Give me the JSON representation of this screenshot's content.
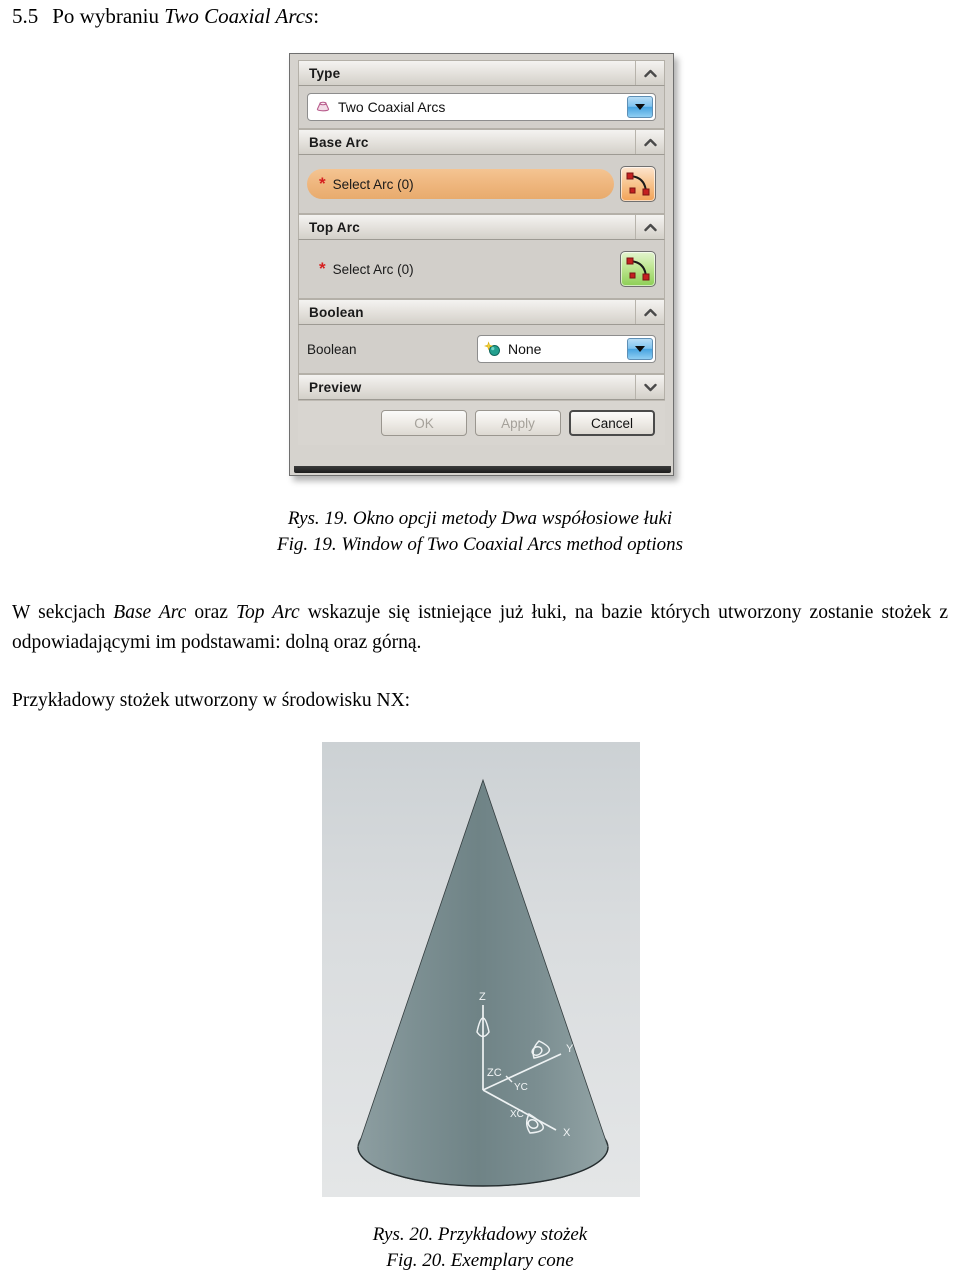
{
  "document": {
    "heading": {
      "number": "5.5",
      "text_before": "Po wybraniu ",
      "italic_term": "Two Coaxial Arcs",
      "text_after": ":"
    },
    "paragraph_1": {
      "seg_1": "W sekcjach ",
      "italic_1": "Base Arc",
      "seg_2": " oraz ",
      "italic_2": "Top Arc",
      "seg_3": " wskazuje się istniejące już łuki, na bazie których utworzony zostanie stożek z odpowiadającymi im podstawami: dolną oraz górną."
    },
    "paragraph_2": "Przykładowy stożek utworzony w środowisku NX:",
    "caption_19": {
      "line_pl": "Rys. 19. Okno opcji metody Dwa współosiowe łuki",
      "line_en": "Fig. 19. Window of Two Coaxial Arcs method options"
    },
    "caption_20": {
      "line_pl": "Rys. 20. Przykładowy stożek",
      "line_en": "Fig. 20. Exemplary cone"
    }
  },
  "dialog": {
    "groups": {
      "type": {
        "header": "Type",
        "chevron": "collapse-up",
        "combo": {
          "value": "Two Coaxial Arcs",
          "icon": "cone-shape-icon",
          "icon_color": "#c2739a"
        }
      },
      "base_arc": {
        "header": "Base Arc",
        "chevron": "collapse-up",
        "required_marker": "*",
        "select_label": "Select Arc (0)",
        "highlighted": true,
        "button_icon": "arc-curve-icon",
        "button_color": "#f2a257"
      },
      "top_arc": {
        "header": "Top Arc",
        "chevron": "collapse-up",
        "required_marker": "*",
        "select_label": "Select Arc (0)",
        "highlighted": false,
        "button_icon": "arc-curve-icon",
        "button_color": "#8dcf55"
      },
      "boolean": {
        "header": "Boolean",
        "chevron": "collapse-up",
        "field_label": "Boolean",
        "combo": {
          "value": "None",
          "icon": "boolean-none-icon",
          "icon_color": "#1f9e8e"
        }
      },
      "preview": {
        "header": "Preview",
        "chevron": "expand-down"
      }
    },
    "buttons": [
      {
        "label": "OK",
        "enabled": false
      },
      {
        "label": "Apply",
        "enabled": false
      },
      {
        "label": "Cancel",
        "enabled": true
      }
    ]
  },
  "cone_figure": {
    "axis_labels": {
      "z": "Z",
      "zc": "ZC",
      "y": "Y",
      "yc": "YC",
      "x": "X",
      "xc": "XC"
    },
    "surface_color": "#7b8d90",
    "background_color": "#d8dbdd"
  }
}
